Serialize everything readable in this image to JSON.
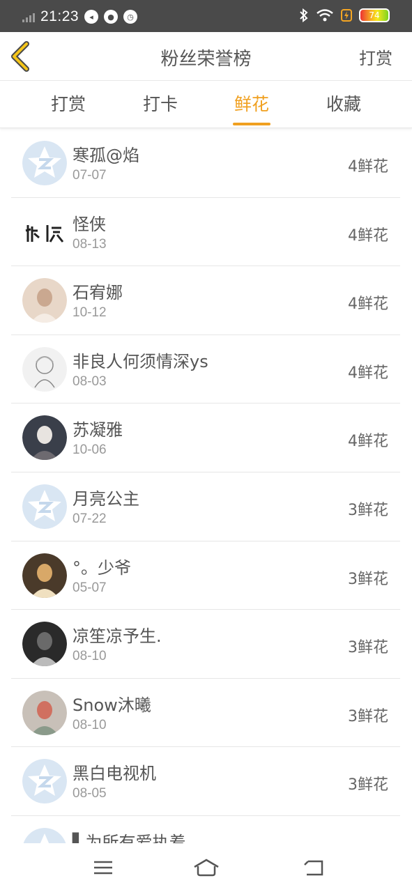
{
  "status_bar": {
    "time": "21:23",
    "battery_level": "74"
  },
  "header": {
    "title": "粉丝荣誉榜",
    "right_action": "打赏"
  },
  "tabs": [
    {
      "label": "打赏",
      "active": false
    },
    {
      "label": "打卡",
      "active": false
    },
    {
      "label": "鲜花",
      "active": true
    },
    {
      "label": "收藏",
      "active": false
    }
  ],
  "accent_color": "#f0a020",
  "rows": [
    {
      "name": "寒孤@焰",
      "date": "07-07",
      "count": "4鲜花",
      "avatar": "default-qq-icon"
    },
    {
      "name": "怪侠",
      "date": "08-13",
      "count": "4鲜花",
      "avatar": "calligraphy-avatar"
    },
    {
      "name": "石宥娜",
      "date": "10-12",
      "count": "4鲜花",
      "avatar": "photo-avatar"
    },
    {
      "name": "非良人何须情深ys",
      "date": "08-03",
      "count": "4鲜花",
      "avatar": "sketch-avatar"
    },
    {
      "name": "苏凝雅",
      "date": "10-06",
      "count": "4鲜花",
      "avatar": "photo-avatar"
    },
    {
      "name": "月亮公主",
      "date": "07-22",
      "count": "3鲜花",
      "avatar": "default-qq-icon"
    },
    {
      "name": "°。少爷",
      "date": "05-07",
      "count": "3鲜花",
      "avatar": "photo-avatar"
    },
    {
      "name": "凉笙凉予生.",
      "date": "08-10",
      "count": "3鲜花",
      "avatar": "photo-avatar"
    },
    {
      "name": "Snow沐曦",
      "date": "08-10",
      "count": "3鲜花",
      "avatar": "photo-avatar"
    },
    {
      "name": "黑白电视机",
      "date": "08-05",
      "count": "3鲜花",
      "avatar": "default-qq-icon"
    },
    {
      "name": "▌为所有爱执着…",
      "date": "",
      "count": "…",
      "avatar": "default-qq-icon"
    }
  ]
}
